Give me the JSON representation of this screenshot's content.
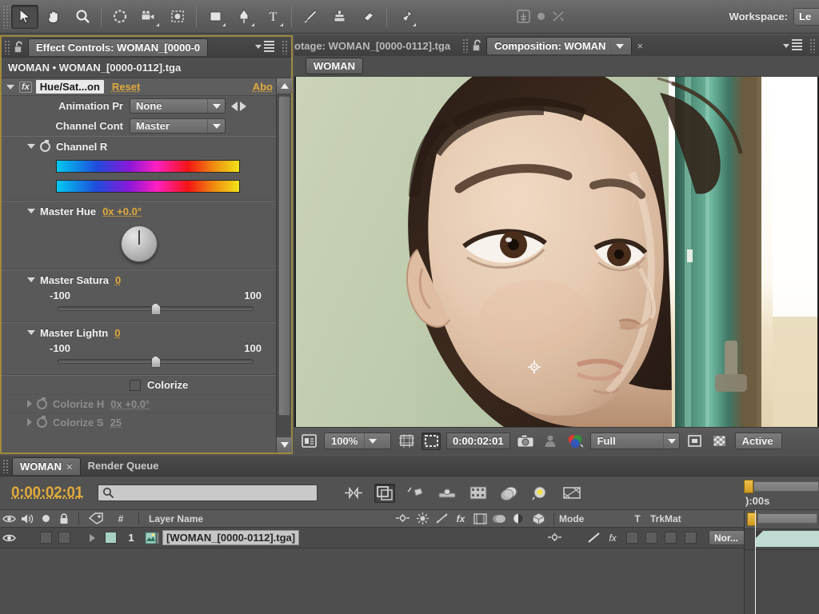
{
  "toolbar": {
    "tools": [
      {
        "name": "selection-tool",
        "title": "Selection",
        "active": true
      },
      {
        "name": "hand-tool",
        "title": "Hand",
        "active": false
      },
      {
        "name": "zoom-tool",
        "title": "Zoom",
        "active": false
      },
      {
        "name": "rotation-tool",
        "title": "Rotation",
        "active": false
      },
      {
        "name": "camera-tool",
        "title": "Unified Camera",
        "active": false
      },
      {
        "name": "pan-behind-tool",
        "title": "Pan Behind",
        "active": false
      },
      {
        "name": "shape-tool",
        "title": "Rectangle",
        "active": false
      },
      {
        "name": "pen-tool",
        "title": "Pen",
        "active": false
      },
      {
        "name": "text-tool",
        "title": "Type",
        "active": false
      },
      {
        "name": "brush-tool",
        "title": "Brush",
        "active": false
      },
      {
        "name": "clone-stamp-tool",
        "title": "Clone Stamp",
        "active": false
      },
      {
        "name": "eraser-tool",
        "title": "Eraser",
        "active": false
      },
      {
        "name": "puppet-pin-tool",
        "title": "Puppet Pin",
        "active": false
      }
    ],
    "workspace_label": "Workspace:",
    "workspace_value": "Le"
  },
  "effect_controls": {
    "tab_title": "Effect Controls: WOMAN_[0000-0",
    "header": "WOMAN • WOMAN_[0000-0112].tga",
    "effect": {
      "name": "Hue/Sat...on",
      "reset_label": "Reset",
      "about_label": "Abo"
    },
    "animation_preset": {
      "label": "Animation Pr",
      "value": "None"
    },
    "channel_control": {
      "label": "Channel Cont",
      "value": "Master"
    },
    "channel_range": {
      "label": "Channel R"
    },
    "master_hue": {
      "label": "Master Hue",
      "value": "0x +0.0°"
    },
    "master_saturation": {
      "label": "Master Satura",
      "value": "0",
      "min": "-100",
      "max": "100",
      "position_pct": 50
    },
    "master_lightness": {
      "label": "Master Lightn",
      "value": "0",
      "min": "-100",
      "max": "100",
      "position_pct": 50
    },
    "colorize": {
      "label": "Colorize",
      "checked": false
    },
    "colorize_hue": {
      "label": "Colorize H",
      "value": "0x +0.0°"
    },
    "colorize_saturation": {
      "label": "Colorize S",
      "value": "25"
    }
  },
  "viewer": {
    "tab_footage": "otage: WOMAN_[0000-0112].tga",
    "tab_composition": "Composition: WOMAN",
    "breadcrumb": "WOMAN",
    "zoom": "100%",
    "timecode": "0:00:02:01",
    "resolution": "Full",
    "view_label": "Active"
  },
  "timeline": {
    "tab_comp": "WOMAN",
    "tab_render_queue": "Render Queue",
    "timecode": "0:00:02:01",
    "search_placeholder": "",
    "columns": {
      "number": "#",
      "layer_name": "Layer Name",
      "mode": "Mode",
      "t": "T",
      "trkmat": "TrkMat"
    },
    "ruler_label": "):00s",
    "layer": {
      "index": "1",
      "name": "[WOMAN_[0000-0112].tga]",
      "mode": "Nor..."
    }
  },
  "colors": {
    "accent_orange": "#e0a93c",
    "panel_bg": "#4e4e4e",
    "highlight_border": "#a08a3c",
    "layer_swatch": "#a8cfc4"
  }
}
